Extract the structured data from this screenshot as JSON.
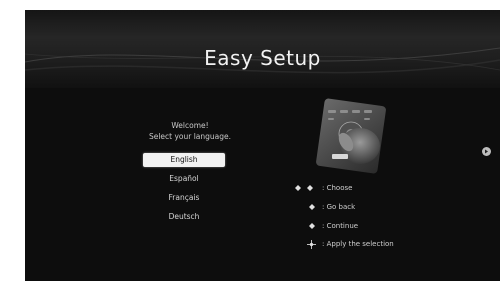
{
  "header": {
    "title": "Easy Setup"
  },
  "welcome": {
    "line1": "Welcome!",
    "line2": "Select your language."
  },
  "languages": [
    {
      "label": "English",
      "selected": true
    },
    {
      "label": "Español",
      "selected": false
    },
    {
      "label": "Français",
      "selected": false
    },
    {
      "label": "Deutsch",
      "selected": false
    }
  ],
  "help": {
    "choose": ": Choose",
    "back": ": Go back",
    "continue": ": Continue",
    "apply": ": Apply the selection"
  },
  "icons": {
    "choose": "up-down-arrows-icon",
    "back": "left-arrow-icon",
    "continue": "right-arrow-icon",
    "apply": "dpad-center-icon",
    "next": "next-page-icon"
  }
}
